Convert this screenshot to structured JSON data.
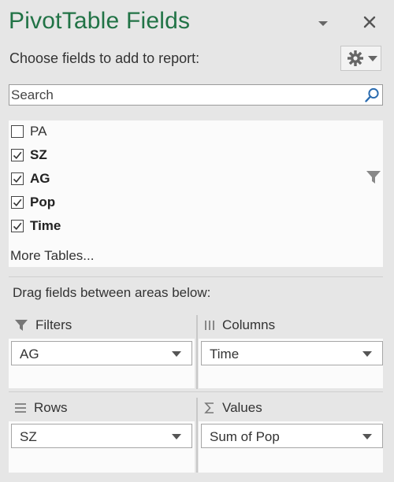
{
  "panel": {
    "title": "PivotTable Fields",
    "choose_label": "Choose fields to add to report:"
  },
  "search": {
    "placeholder": "Search"
  },
  "fields": [
    {
      "label": "PA",
      "checked": false
    },
    {
      "label": "SZ",
      "checked": true
    },
    {
      "label": "AG",
      "checked": true
    },
    {
      "label": "Pop",
      "checked": true
    },
    {
      "label": "Time",
      "checked": true
    }
  ],
  "more_tables": "More Tables...",
  "drag_label": "Drag fields between areas below:",
  "areas": {
    "filters": {
      "label": "Filters",
      "item": "AG"
    },
    "columns": {
      "label": "Columns",
      "item": "Time"
    },
    "rows": {
      "label": "Rows",
      "item": "SZ"
    },
    "values": {
      "label": "Values",
      "item": "Sum of Pop"
    }
  },
  "colors": {
    "accent": "#217346",
    "panel_bg": "#e6e6e6",
    "list_bg": "#fbfbfb"
  },
  "icons": [
    "chevron-down-icon",
    "close-icon",
    "gear-icon",
    "search-icon",
    "funnel-icon",
    "columns-icon",
    "rows-icon",
    "sigma-icon"
  ]
}
